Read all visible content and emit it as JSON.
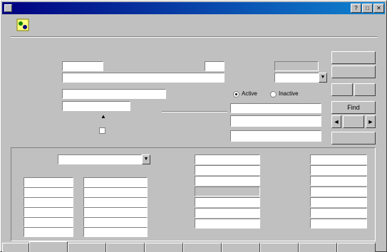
{
  "title": "",
  "hint": "",
  "header": {
    "number_label": "",
    "number_value": "",
    "description_label": "",
    "description_value": "",
    "location_label": "",
    "location_value": "",
    "primary_label": "",
    "primary_value": "",
    "unit_label": "",
    "unit_value": "",
    "secondary_label": "",
    "secondary_value": "",
    "category_label": "",
    "category_value": "",
    "checkbox_label": "",
    "radio_active": "Active",
    "radio_inactive": "Inactive",
    "lookup_label": "",
    "lookup_value": "",
    "reference_label": "",
    "reference_value": "",
    "extra_value": ""
  },
  "buttons": {
    "save": "",
    "cancel": "",
    "new": "",
    "delete": "",
    "find": "Find",
    "nav_prev": "◄",
    "nav_next": "►",
    "nav_mid": "",
    "help": ""
  },
  "detail": {
    "type_label": "",
    "type_value": "",
    "col_a_header": "",
    "col_b_header": "",
    "rows": [
      {
        "num": "",
        "a": "",
        "b": ""
      },
      {
        "num": "",
        "a": "",
        "b": ""
      },
      {
        "num": "",
        "a": "",
        "b": ""
      },
      {
        "num": "",
        "a": "",
        "b": ""
      },
      {
        "num": "",
        "a": "",
        "b": ""
      },
      {
        "num": "",
        "a": "",
        "b": ""
      }
    ],
    "mid_fields": [
      {
        "label": "",
        "value": ""
      },
      {
        "label": "",
        "value": ""
      },
      {
        "label": "",
        "value": ""
      },
      {
        "label": "",
        "value": ""
      },
      {
        "label": "",
        "value": ""
      },
      {
        "label": "",
        "value": ""
      },
      {
        "label": "",
        "value": ""
      }
    ],
    "right_fields": [
      {
        "label": "",
        "value": ""
      },
      {
        "label": "",
        "value": ""
      },
      {
        "label": "",
        "value": ""
      },
      {
        "label": "",
        "value": ""
      },
      {
        "label": "",
        "value": ""
      },
      {
        "label": "",
        "value": ""
      },
      {
        "label": "",
        "value": ""
      }
    ]
  },
  "tabs": [
    "",
    "",
    "",
    "",
    "",
    "",
    "",
    "",
    "",
    ""
  ],
  "colors": {
    "title_start": "#000080",
    "title_end": "#1084d0",
    "face": "#c0c0c0"
  }
}
